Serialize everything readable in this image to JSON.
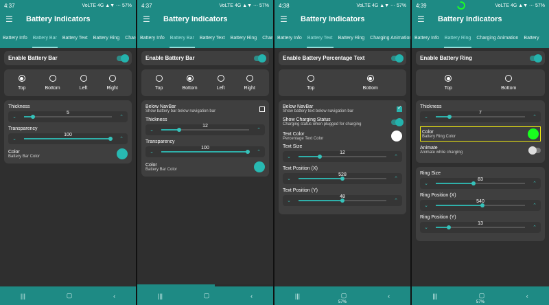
{
  "screens": [
    {
      "status": {
        "time": "4:37",
        "icons": "VoLTE 4G ▲▼ ⋯ 57%"
      },
      "title": "Battery Indicators",
      "tabs": [
        "Battery Info",
        "Battery Bar",
        "Battery Text",
        "Battery Ring",
        "Charging"
      ],
      "activeTab": 1,
      "enable": {
        "label": "Enable Battery Bar"
      },
      "positions": [
        "Top",
        "Bottom",
        "Left",
        "Right"
      ],
      "selected": 0,
      "thickness": {
        "label": "Thickness",
        "value": "5"
      },
      "transparency": {
        "label": "Transparency",
        "value": "100"
      },
      "color": {
        "label": "Color",
        "sub": "Battery Bar Color"
      }
    },
    {
      "status": {
        "time": "4:37",
        "icons": "VoLTE 4G ▲▼ ⋯ 57%"
      },
      "title": "Battery Indicators",
      "tabs": [
        "Battery Info",
        "Battery Bar",
        "Battery Text",
        "Battery Ring",
        "Chargingp"
      ],
      "activeTab": 1,
      "enable": {
        "label": "Enable Battery Bar"
      },
      "positions": [
        "Top",
        "Bottom",
        "Left",
        "Right"
      ],
      "selected": 1,
      "below": {
        "label": "Below NavBar",
        "sub": "Show battery bar below navigation bar"
      },
      "thickness": {
        "label": "Thickness",
        "value": "12"
      },
      "transparency": {
        "label": "Transparency",
        "value": "100"
      },
      "color": {
        "label": "Color",
        "sub": "Battery Bar Color"
      }
    },
    {
      "status": {
        "time": "4:38",
        "icons": "VoLTE 4G ▲▼ ⋯ 57%"
      },
      "title": "Battery Indicators",
      "tabs": [
        "Battery Info",
        "Battery Text",
        "Battery Ring",
        "Charging Animation"
      ],
      "activeTab": 1,
      "enable": {
        "label": "Enable Battery Percentage Text"
      },
      "positions": [
        "Top",
        "Bottom"
      ],
      "selected": 1,
      "below": {
        "label": "Below NavBar",
        "sub": "Show battery text below navigation bar"
      },
      "charging": {
        "label": "Show Charging Status",
        "sub": "Charging status when plugged for charging"
      },
      "textColor": {
        "label": "Text Color",
        "sub": "Percentage Text Color"
      },
      "textSize": {
        "label": "Text Size",
        "value": "12"
      },
      "posX": {
        "label": "Text Position (X)",
        "value": "528"
      },
      "posY": {
        "label": "Text Position (Y)",
        "value": "48"
      },
      "battery": "57%"
    },
    {
      "status": {
        "time": "4:39",
        "icons": "VoLTE 4G ▲▼ ⋯ 57%"
      },
      "title": "Battery Indicators",
      "tabs": [
        "Battery Info",
        "Battery Ring",
        "Charging Animation",
        "Battery"
      ],
      "activeTab": 1,
      "enable": {
        "label": "Enable Battery Ring"
      },
      "positions": [
        "Top",
        "Bottom"
      ],
      "selected": 0,
      "thickness": {
        "label": "Thickness",
        "value": "7"
      },
      "color": {
        "label": "Color",
        "sub": "Battery Ring Color"
      },
      "animate": {
        "label": "Animate",
        "sub": "Animate while charging"
      },
      "size": {
        "label": "Ring Size",
        "value": "83"
      },
      "posX": {
        "label": "Ring Position (X)",
        "value": "540"
      },
      "posY": {
        "label": "Ring Position (Y)",
        "value": "13"
      },
      "battery": "57%"
    }
  ],
  "icons": {
    "menu": "menu-icon",
    "up": "chevron-up-icon",
    "down": "chevron-down-icon",
    "nav_recents": "recent-apps-icon",
    "nav_home": "home-icon",
    "nav_back": "back-icon",
    "status_ring": "battery-ring-icon"
  },
  "colors": {
    "accent": "#1e8a84",
    "knob": "#36c2ba",
    "selected_color": "#18ff1e"
  }
}
